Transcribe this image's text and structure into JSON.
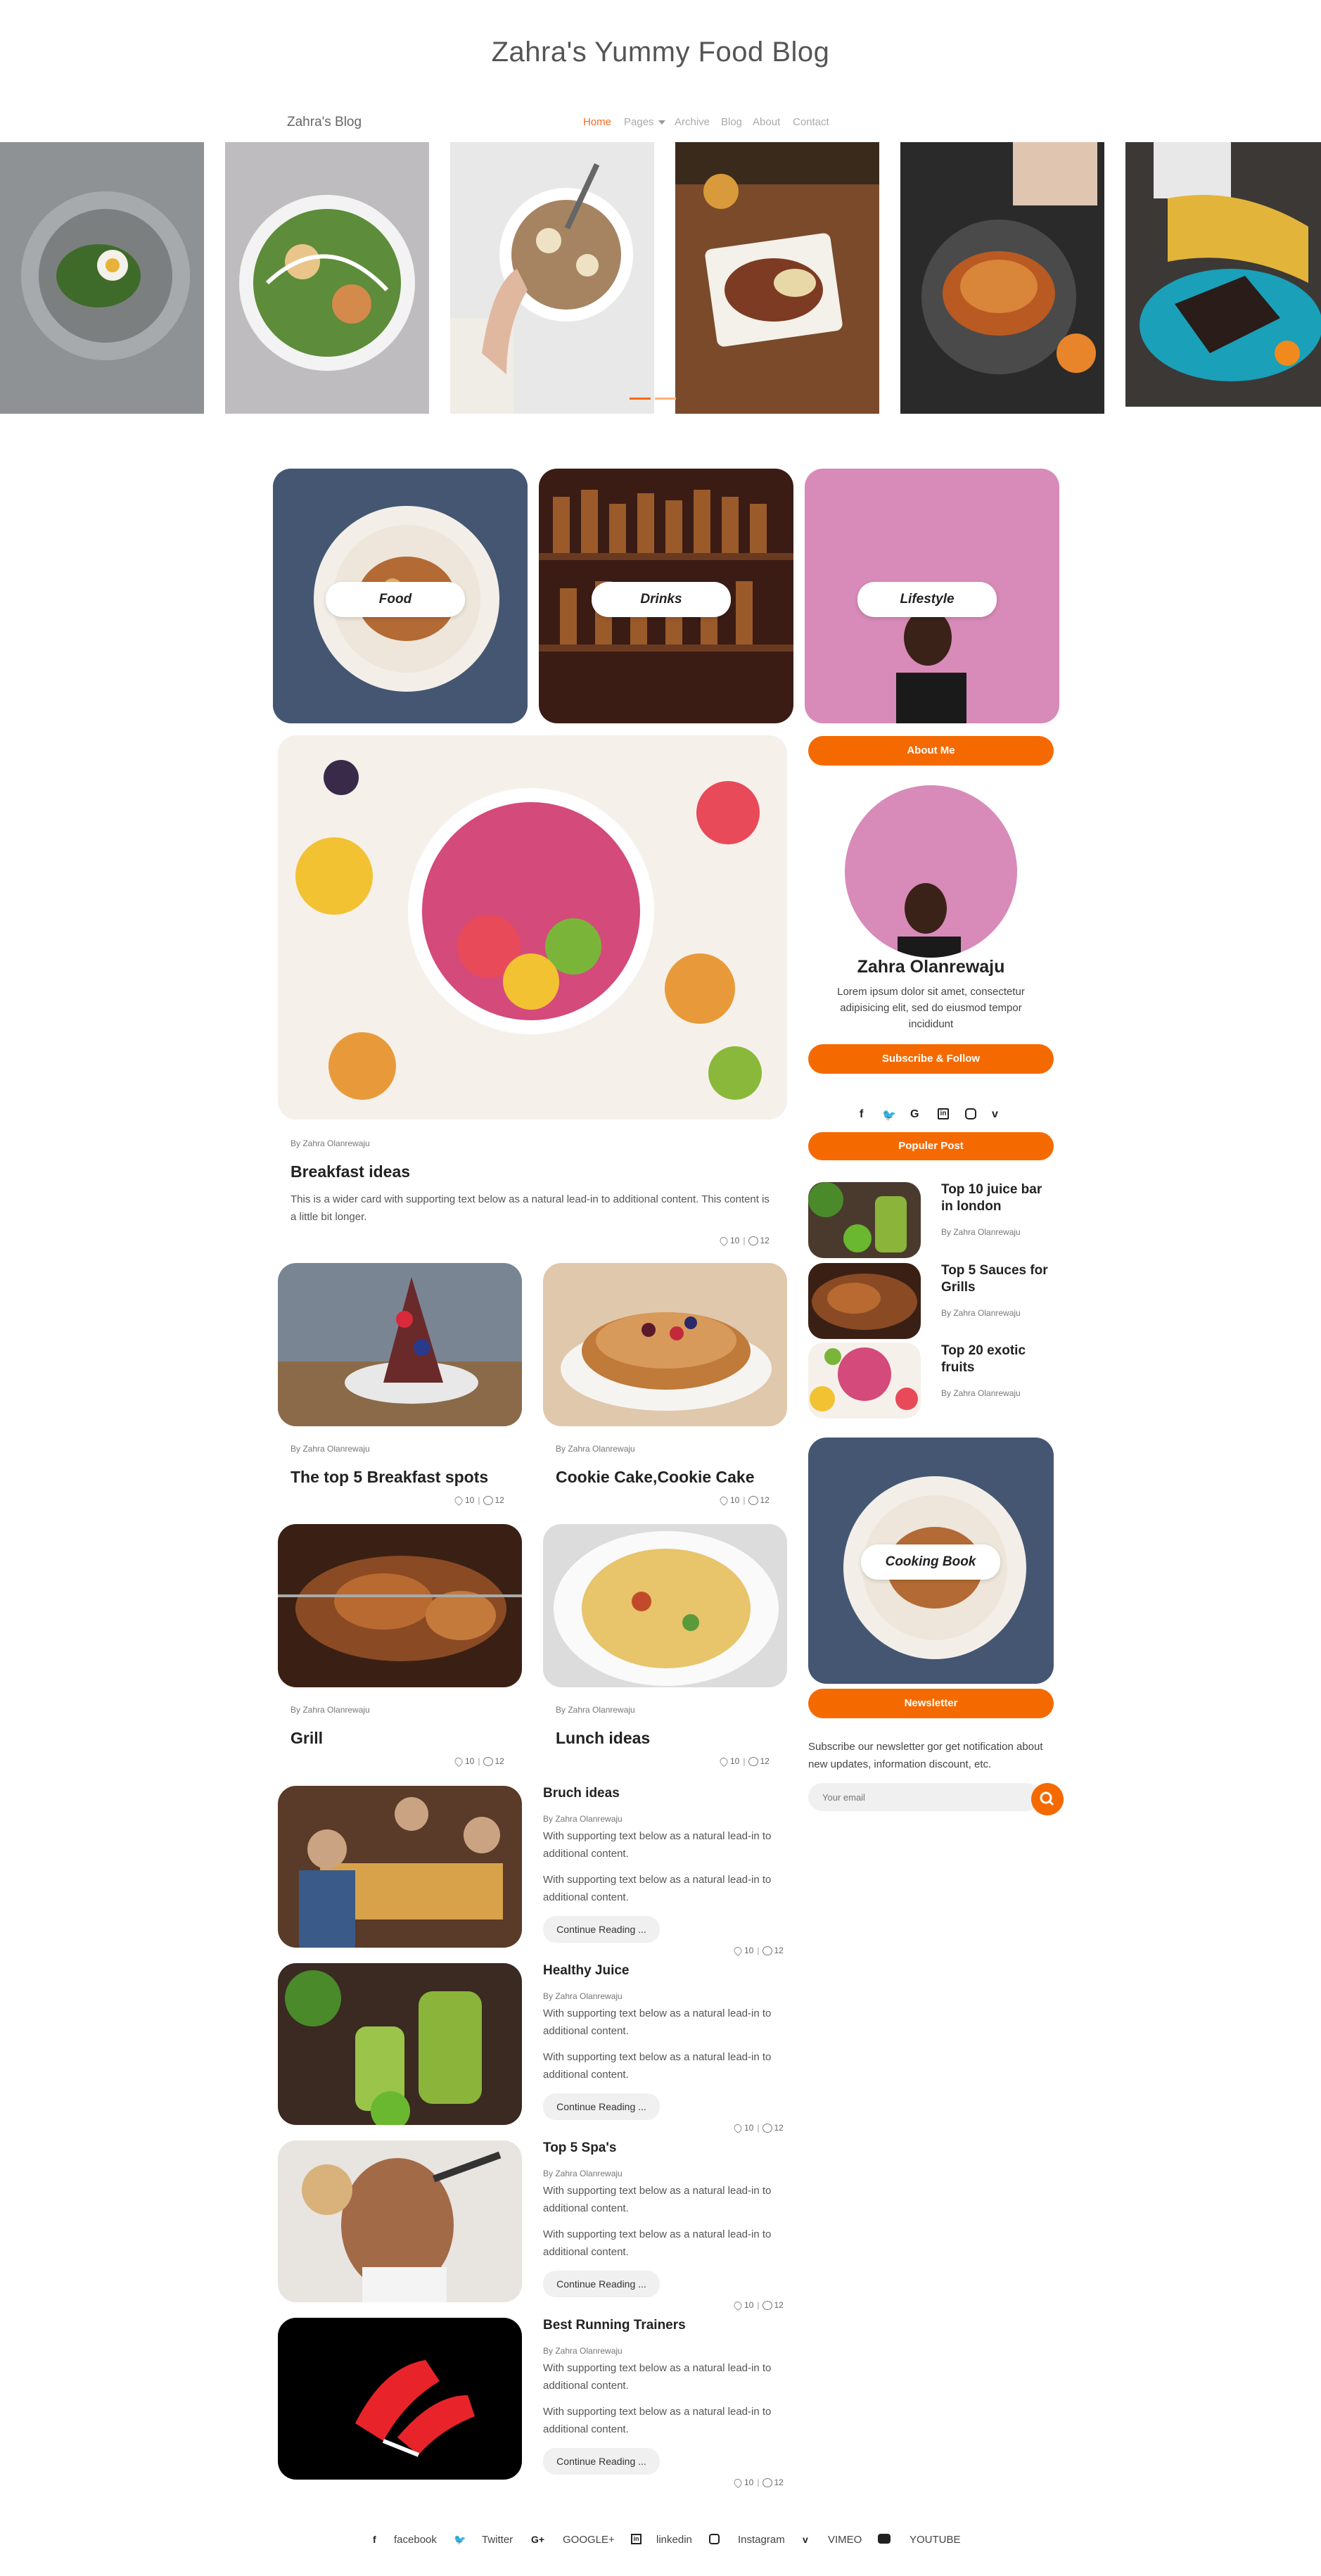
{
  "header": {
    "title": "Zahra's Yummy Food Blog",
    "brand": "Zahra's Blog"
  },
  "nav": {
    "home": "Home",
    "pages": "Pages",
    "archive": "Archive",
    "blog": "Blog",
    "about": "About",
    "contact": "Contact"
  },
  "categories": {
    "food": "Food",
    "drinks": "Drinks",
    "lifestyle": "Lifestyle"
  },
  "featured": {
    "author": "By Zahra Olanrewaju",
    "title": "Breakfast ideas",
    "text": "This is a wider card with supporting text below as a natural lead-in to additional content. This content is a little bit longer.",
    "likes": "10",
    "comments": "12"
  },
  "grid_cards": [
    {
      "author": "By Zahra Olanrewaju",
      "title": "The top 5 Breakfast spots",
      "likes": "10",
      "comments": "12"
    },
    {
      "author": "By Zahra Olanrewaju",
      "title": "Cookie Cake,Cookie Cake",
      "likes": "10",
      "comments": "12"
    },
    {
      "author": "By Zahra Olanrewaju",
      "title": "Grill",
      "likes": "10",
      "comments": "12"
    },
    {
      "author": "By Zahra Olanrewaju",
      "title": "Lunch ideas",
      "likes": "10",
      "comments": "12"
    }
  ],
  "list_posts": [
    {
      "title": "Bruch ideas",
      "author": "By Zahra Olanrewaju",
      "text1": "With supporting text below as a natural lead-in to additional content.",
      "text2": "With supporting text below as a natural lead-in to additional content.",
      "button": "Continue Reading ...",
      "likes": "10",
      "comments": "12"
    },
    {
      "title": "Healthy Juice",
      "author": "By Zahra Olanrewaju",
      "text1": "With supporting text below as a natural lead-in to additional content.",
      "text2": "With supporting text below as a natural lead-in to additional content.",
      "button": "Continue Reading ...",
      "likes": "10",
      "comments": "12"
    },
    {
      "title": "Top 5 Spa's",
      "author": "By Zahra Olanrewaju",
      "text1": "With supporting text below as a natural lead-in to additional content.",
      "text2": "With supporting text below as a natural lead-in to additional content.",
      "button": "Continue Reading ...",
      "likes": "10",
      "comments": "12"
    },
    {
      "title": "Best Running Trainers",
      "author": "By Zahra Olanrewaju",
      "text1": "With supporting text below as a natural lead-in to additional content.",
      "text2": "With supporting text below as a natural lead-in to additional content.",
      "button": "Continue Reading ...",
      "likes": "10",
      "comments": "12"
    }
  ],
  "sidebar": {
    "about_button": "About Me",
    "name": "Zahra Olanrewaju",
    "bio": "Lorem ipsum dolor sit amet, consectetur adipisicing elit, sed do eiusmod tempor incididunt",
    "subscribe_button": "Subscribe & Follow",
    "popular_button": "Populer Post",
    "popular": [
      {
        "title": "Top 10 juice bar in london",
        "author": "By Zahra Olanrewaju"
      },
      {
        "title": "Top 5 Sauces for Grills",
        "author": "By Zahra Olanrewaju"
      },
      {
        "title": "Top 20 exotic fruits",
        "author": "By Zahra Olanrewaju"
      }
    ],
    "cooking_book": "Cooking Book",
    "newsletter_button": "Newsletter",
    "newsletter_text": "Subscribe our newsletter gor get notification about new updates, information discount, etc.",
    "email_placeholder": "Your email"
  },
  "footer": {
    "facebook": "facebook",
    "twitter": "Twitter",
    "google": "GOOGLE+",
    "linkedin": "linkedin",
    "instagram": "Instagram",
    "vimeo": "VIMEO",
    "youtube": "YOUTUBE"
  },
  "colors": {
    "accent": "#f56a00",
    "nav_active": "#f26a1b"
  }
}
